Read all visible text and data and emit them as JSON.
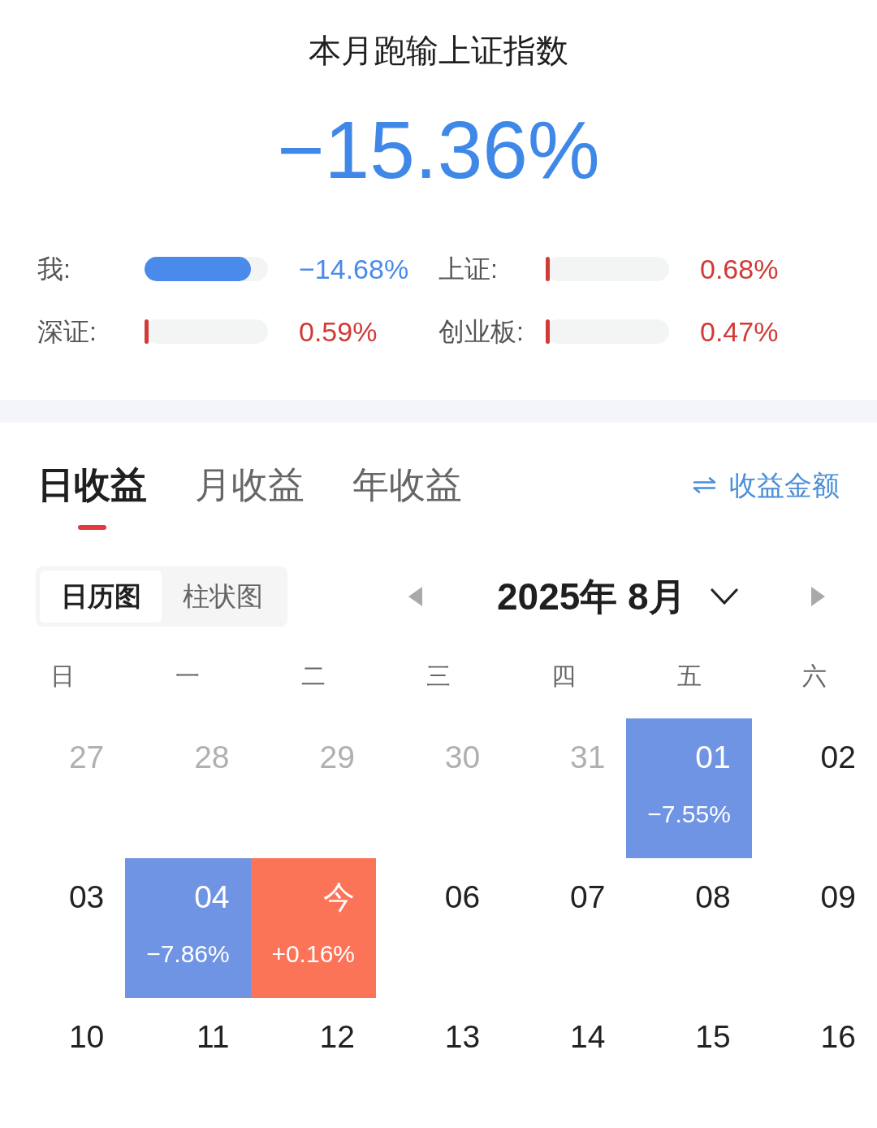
{
  "header": {
    "title": "本月跑输上证指数",
    "excess_return": "−15.36%"
  },
  "comparisons": [
    {
      "label": "我:",
      "level": 0.86,
      "color": "#4a8aea",
      "value": "−14.68%"
    },
    {
      "label": "上证:",
      "level": 0.03,
      "color": "#d13a36",
      "value": "0.68%"
    },
    {
      "label": "深证:",
      "level": 0.03,
      "color": "#d13a36",
      "value": "0.59%"
    },
    {
      "label": "创业板:",
      "level": 0.03,
      "color": "#d13a36",
      "value": "0.47%"
    }
  ],
  "tabs": [
    {
      "label": "日收益",
      "selected": true
    },
    {
      "label": "月收益",
      "selected": false
    },
    {
      "label": "年收益",
      "selected": false
    }
  ],
  "amount_toggle": {
    "label": "收益金额"
  },
  "view_switch": [
    {
      "label": "日历图",
      "selected": true
    },
    {
      "label": "柱状图",
      "selected": false
    }
  ],
  "month_picker": {
    "label": "2025年 8月"
  },
  "calendar": {
    "weekdays": [
      "日",
      "一",
      "二",
      "三",
      "四",
      "五",
      "六"
    ],
    "weeks": [
      [
        {
          "day": "27",
          "in_month": false
        },
        {
          "day": "28",
          "in_month": false
        },
        {
          "day": "29",
          "in_month": false
        },
        {
          "day": "30",
          "in_month": false
        },
        {
          "day": "31",
          "in_month": false
        },
        {
          "day": "01",
          "in_month": true,
          "change": "−7.55%",
          "color": "#7094e4"
        },
        {
          "day": "02",
          "in_month": true
        }
      ],
      [
        {
          "day": "03",
          "in_month": true
        },
        {
          "day": "04",
          "in_month": true,
          "change": "−7.86%",
          "color": "#7094e4"
        },
        {
          "day": "今",
          "in_month": true,
          "change": "+0.16%",
          "color": "#fc7458"
        },
        {
          "day": "06",
          "in_month": true
        },
        {
          "day": "07",
          "in_month": true
        },
        {
          "day": "08",
          "in_month": true
        },
        {
          "day": "09",
          "in_month": true
        }
      ],
      [
        {
          "day": "10",
          "in_month": true
        },
        {
          "day": "11",
          "in_month": true
        },
        {
          "day": "12",
          "in_month": true
        },
        {
          "day": "13",
          "in_month": true
        },
        {
          "day": "14",
          "in_month": true
        },
        {
          "day": "15",
          "in_month": true
        },
        {
          "day": "16",
          "in_month": true
        }
      ]
    ]
  }
}
